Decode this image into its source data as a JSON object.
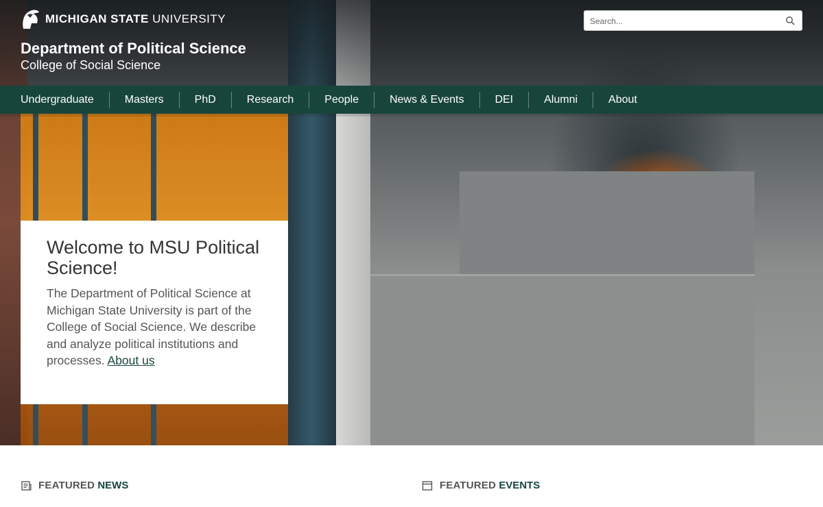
{
  "header": {
    "university_bold": "MICHIGAN STATE",
    "university_light": "UNIVERSITY",
    "dept_title": "Department of Political Science",
    "dept_subtitle": "College of Social Science"
  },
  "search": {
    "placeholder": "Search...",
    "icon": "search-icon"
  },
  "nav": {
    "items": [
      "Undergraduate",
      "Masters",
      "PhD",
      "Research",
      "People",
      "News & Events",
      "DEI",
      "Alumni",
      "About"
    ]
  },
  "welcome": {
    "heading": "Welcome to MSU Political Science!",
    "body": "The Department of Political Science at Michigan State University is part of the College of Social Science. We describe and analyze political institutions and processes.",
    "link": "About us"
  },
  "featured": {
    "news_a": "FEATURED",
    "news_b": "NEWS",
    "news_icon": "newspaper-icon",
    "events_a": "FEATURED",
    "events_b": "EVENTS",
    "events_icon": "calendar-icon"
  },
  "colors": {
    "brand_green": "#18453b",
    "text_gray": "#555555"
  }
}
